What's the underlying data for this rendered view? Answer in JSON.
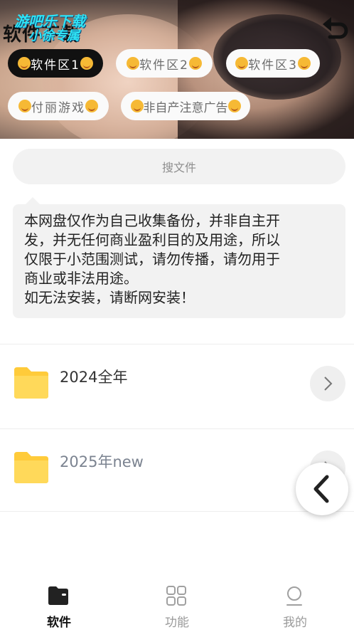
{
  "header": {
    "logo_text_black": "软件下载",
    "logo_line1": "游吧乐下载",
    "logo_line2": "小徐专属",
    "back_icon": "undo-arrow-icon"
  },
  "tabs_categories": [
    {
      "label": "软件区1",
      "active": true
    },
    {
      "label": "软件区2",
      "active": false
    },
    {
      "label": "软件区3",
      "active": false
    },
    {
      "label": "付丽游戏",
      "active": false
    },
    {
      "label": "非自产注意广告",
      "active": false
    }
  ],
  "search": {
    "placeholder": "搜文件"
  },
  "notice": {
    "text_line1": "本网盘仅作为自己收集备份，并非自主开",
    "text_line2": "发，并无任何商业盈利目的及用途，所以",
    "text_line3": "仅限于小范围测试，请勿传播，请勿用于",
    "text_line4": "商业或非法用途。",
    "text_line5": "如无法安装，请断网安装！"
  },
  "folders": [
    {
      "name": "2024全年",
      "icon": "folder-icon",
      "arrow": "chevron-right-icon"
    },
    {
      "name": "2025年new",
      "icon": "folder-icon",
      "arrow": "chevron-right-icon"
    }
  ],
  "float_button": {
    "icon": "chevron-left-icon"
  },
  "bottom_nav": [
    {
      "label": "软件",
      "icon": "folder-icon",
      "active": true
    },
    {
      "label": "功能",
      "icon": "grid-icon",
      "active": false
    },
    {
      "label": "我的",
      "icon": "user-icon",
      "active": false
    }
  ],
  "colors": {
    "accent": "#111111",
    "folder": "#ffd34d",
    "logo_cyan": "#2fe3f5"
  }
}
